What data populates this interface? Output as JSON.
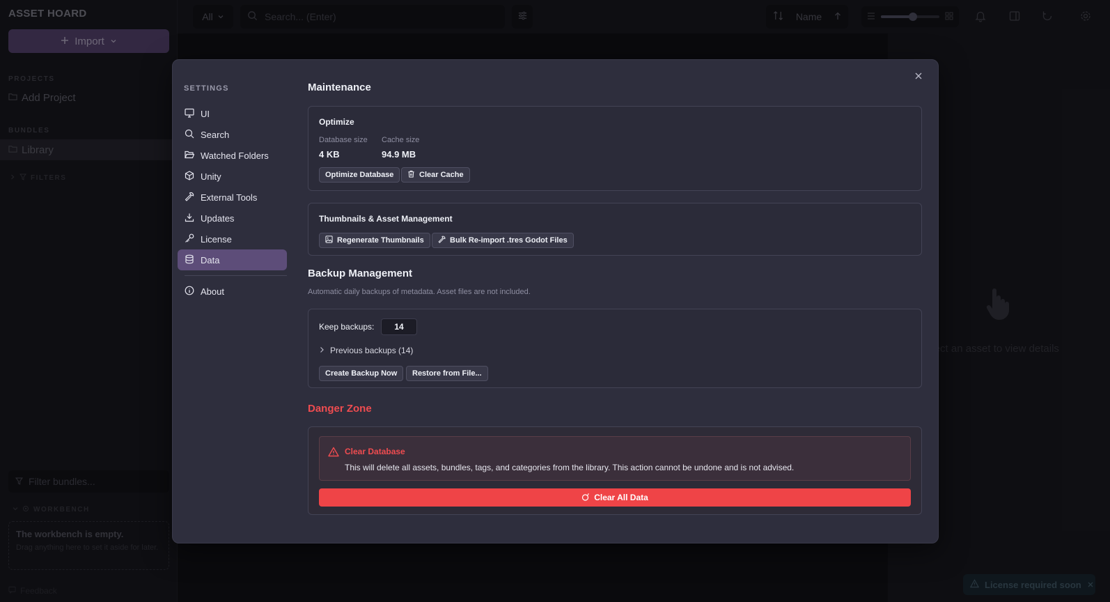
{
  "app": {
    "title": "ASSET HOARD",
    "import_label": "Import",
    "projects_label": "PROJECTS",
    "add_project_label": "Add Project",
    "bundles_label": "BUNDLES",
    "library_label": "Library",
    "filters_label": "FILTERS",
    "filter_bundles_placeholder": "Filter bundles...",
    "workbench_label": "WORKBENCH",
    "workbench_empty_title": "The workbench is empty.",
    "workbench_empty_sub": "Drag anything here to set it aside for later.",
    "feedback_label": "Feedback"
  },
  "topbar": {
    "scope_value": "All",
    "search_placeholder": "Search... (Enter)",
    "sort_label": "Name",
    "zoom_fraction": 0.55
  },
  "details": {
    "empty_text": "elect an asset to view details"
  },
  "toast": {
    "text": "License required soon"
  },
  "settings": {
    "heading": "SETTINGS",
    "nav": [
      {
        "label": "UI",
        "icon": "monitor-icon"
      },
      {
        "label": "Search",
        "icon": "search-icon"
      },
      {
        "label": "Watched Folders",
        "icon": "folder-open-icon"
      },
      {
        "label": "Unity",
        "icon": "cube-icon"
      },
      {
        "label": "External Tools",
        "icon": "wrench-icon"
      },
      {
        "label": "Updates",
        "icon": "download-icon"
      },
      {
        "label": "License",
        "icon": "key-icon"
      },
      {
        "label": "Data",
        "icon": "database-icon",
        "active": true
      }
    ],
    "about_label": "About"
  },
  "maintenance": {
    "title": "Maintenance",
    "optimize": {
      "title": "Optimize",
      "db_size_label": "Database size",
      "db_size_value": "4 KB",
      "cache_size_label": "Cache size",
      "cache_size_value": "94.9 MB",
      "optimize_btn": "Optimize Database",
      "clear_cache_btn": "Clear Cache"
    },
    "thumbnails": {
      "title": "Thumbnails & Asset Management",
      "regenerate_btn": "Regenerate Thumbnails",
      "reimport_btn": "Bulk Re-import .tres Godot Files"
    }
  },
  "backup": {
    "title": "Backup Management",
    "description": "Automatic daily backups of metadata. Asset files are not included.",
    "keep_label": "Keep backups:",
    "keep_value": "14",
    "previous_label": "Previous backups (14)",
    "create_btn": "Create Backup Now",
    "restore_btn": "Restore from File..."
  },
  "danger": {
    "title": "Danger Zone",
    "clear_title": "Clear Database",
    "clear_text": "This will delete all assets, bundles, tags, and categories from the library. This action cannot be undone and is not advised.",
    "clear_btn": "Clear All Data",
    "color": "#ef4447"
  }
}
